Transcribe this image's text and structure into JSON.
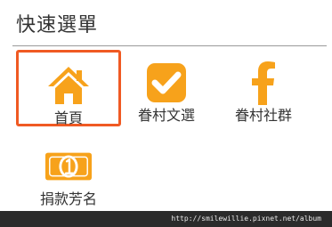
{
  "header": {
    "title": "快速選單"
  },
  "menu": {
    "items": [
      {
        "label": "首頁",
        "icon": "home-icon",
        "active": true
      },
      {
        "label": "眷村文選",
        "icon": "checkbox-icon",
        "active": false
      },
      {
        "label": "眷村社群",
        "icon": "facebook-icon",
        "active": false
      },
      {
        "label": "捐款芳名",
        "icon": "money-icon",
        "active": false
      }
    ]
  },
  "footer": {
    "watermark": "http://smilewillie.pixnet.net/album"
  },
  "colors": {
    "icon": "#f7a21b",
    "active_border": "#f05a23",
    "text": "#333333",
    "footer_bg": "#2b2b2b"
  }
}
